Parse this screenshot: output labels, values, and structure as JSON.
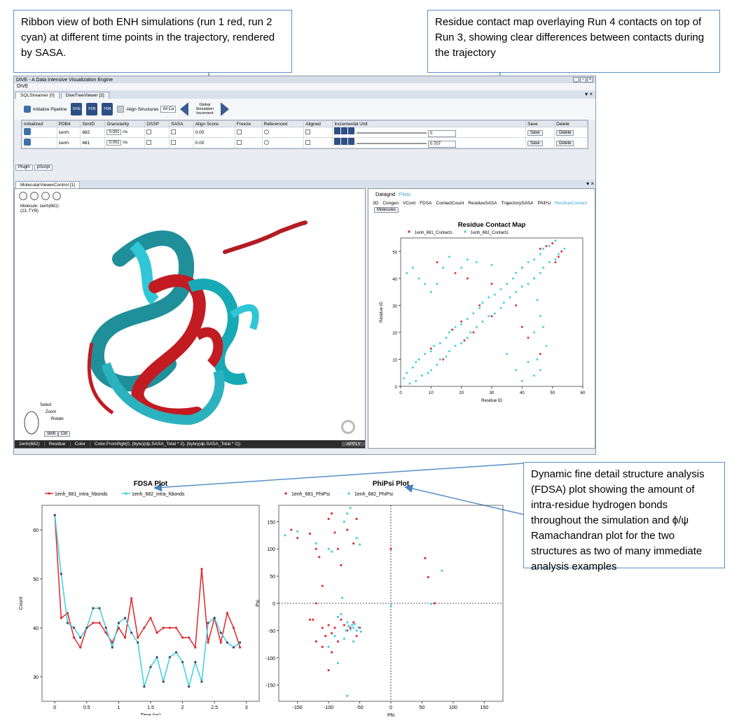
{
  "callouts": {
    "ribbon": "Ribbon view of both ENH simulations (run 1 red, run 2 cyan) at different time points in the trajectory, rendered by SASA.",
    "contact": "Residue contact map overlaying Run 4 contacts on top of Run 3, showing clear differences between contacts during the trajectory",
    "fdsa": "Dynamic fine detail structure analysis (FDSA) plot showing the amount of intra-residue hydrogen bonds throughout the simulation and ϕ/ψ Ramachandran plot for the two structures as two of many immediate analysis examples"
  },
  "app": {
    "title": "DIVE - A Data Intensive Visualization Engine",
    "menu": "DIVE",
    "tabs": [
      "SQLStreamer [0]",
      "DiveTreeViewer [2]"
    ],
    "toolbar": {
      "init": "Initialize Pipeline",
      "align": "Align Structures",
      "align_select": "All Ca",
      "global": "Global Simulation Increment"
    },
    "grid_headers": [
      "Initialized",
      "PDB4",
      "SimID",
      "Granularity",
      "DSSP",
      "SASA",
      "Align Score",
      "Freeze",
      "Referenced",
      "Aligned",
      "Incremental Unit",
      "Save",
      "Delete"
    ],
    "rows": [
      {
        "pdb": "1enh",
        "sim": "682",
        "gran": "0.001",
        "unit": "ns",
        "score": "0.00",
        "value": "0",
        "save": "Save",
        "delete": "Delete"
      },
      {
        "pdb": "1enh",
        "sim": "681",
        "gran": "0.001",
        "unit": "ns",
        "score": "0.00",
        "value": "0.707",
        "save": "Save",
        "delete": "Delete"
      }
    ],
    "bottom_tabs": [
      "Plugin",
      "pScript"
    ],
    "mvc_tab": "MolecularViewerControl [1]",
    "mol_info": [
      "Molecule: 1enh(681)",
      "(23, TYR)"
    ],
    "mouse_help": [
      "Select",
      "Zoom",
      "Rotate"
    ],
    "mouse_keys": [
      "Shift",
      "Ctrl"
    ],
    "status": [
      "1enh(682)",
      "Residue",
      "Color",
      "Color.FromRgb(0, (byte)(dp.SASA_Total * 2), (byte)(dp.SASA_Total * 2))",
      "APPLY"
    ],
    "datagrid": "Datagrid",
    "plots": "Plots",
    "plot_tabs": [
      "3D",
      "Congen",
      "VCont",
      "FDSA",
      "ContactCount",
      "ResidueSASA",
      "TrajectorySASA",
      "PhiPsi",
      "ResidueContact"
    ],
    "molecules_btn": "Molecules"
  },
  "colors": {
    "run1": "#e0262b",
    "run2": "#3ccfe0",
    "callout_border": "#5b8fc7"
  },
  "chart_data": [
    {
      "type": "scatter",
      "title": "Residue Contact Map",
      "xlabel": "Residue ID",
      "ylabel": "Residue ID",
      "xlim": [
        0,
        60
      ],
      "ylim": [
        0,
        55
      ],
      "xticks": [
        "0",
        "10",
        "20",
        "30",
        "40",
        "50",
        "60"
      ],
      "yticks": [
        "0",
        "10",
        "20",
        "30",
        "40",
        "50"
      ],
      "series": [
        {
          "name": "1enh_681_Contacts",
          "points": [
            [
              10,
              14
            ],
            [
              14,
              10
            ],
            [
              17,
              21
            ],
            [
              21,
              17
            ],
            [
              20,
              24
            ],
            [
              24,
              20
            ],
            [
              26,
              30
            ],
            [
              30,
              26
            ],
            [
              46,
              51
            ],
            [
              51,
              46
            ],
            [
              48,
              52
            ],
            [
              52,
              48
            ],
            [
              50,
              53
            ],
            [
              53,
              50
            ],
            [
              18,
              42
            ],
            [
              42,
              18
            ],
            [
              12,
              46
            ],
            [
              46,
              12
            ],
            [
              22,
              40
            ],
            [
              40,
              22
            ],
            [
              38,
              30
            ],
            [
              30,
              38
            ],
            [
              44,
              40
            ],
            [
              40,
              44
            ]
          ]
        },
        {
          "name": "1enh_682_Contacts",
          "points": [
            [
              1,
              3
            ],
            [
              3,
              1
            ],
            [
              2,
              5
            ],
            [
              5,
              2
            ],
            [
              4,
              7
            ],
            [
              7,
              4
            ],
            [
              5,
              9
            ],
            [
              9,
              5
            ],
            [
              6,
              10
            ],
            [
              10,
              6
            ],
            [
              8,
              12
            ],
            [
              12,
              8
            ],
            [
              10,
              13
            ],
            [
              13,
              10
            ],
            [
              11,
              15
            ],
            [
              15,
              11
            ],
            [
              13,
              16
            ],
            [
              16,
              13
            ],
            [
              15,
              18
            ],
            [
              18,
              15
            ],
            [
              16,
              20
            ],
            [
              20,
              16
            ],
            [
              18,
              22
            ],
            [
              22,
              18
            ],
            [
              20,
              23
            ],
            [
              23,
              20
            ],
            [
              22,
              25
            ],
            [
              25,
              22
            ],
            [
              24,
              27
            ],
            [
              27,
              24
            ],
            [
              26,
              29
            ],
            [
              29,
              26
            ],
            [
              27,
              31
            ],
            [
              31,
              27
            ],
            [
              29,
              33
            ],
            [
              33,
              29
            ],
            [
              31,
              34
            ],
            [
              34,
              31
            ],
            [
              33,
              36
            ],
            [
              36,
              33
            ],
            [
              35,
              38
            ],
            [
              38,
              35
            ],
            [
              37,
              40
            ],
            [
              40,
              37
            ],
            [
              38,
              42
            ],
            [
              42,
              38
            ],
            [
              40,
              44
            ],
            [
              44,
              40
            ],
            [
              42,
              46
            ],
            [
              46,
              42
            ],
            [
              44,
              47
            ],
            [
              47,
              44
            ],
            [
              46,
              49
            ],
            [
              49,
              46
            ],
            [
              47,
              51
            ],
            [
              51,
              47
            ],
            [
              49,
              52
            ],
            [
              52,
              49
            ],
            [
              51,
              54
            ],
            [
              54,
              51
            ],
            [
              2,
              42
            ],
            [
              4,
              44
            ],
            [
              6,
              40
            ],
            [
              8,
              38
            ],
            [
              10,
              35
            ],
            [
              12,
              38
            ],
            [
              14,
              44
            ],
            [
              16,
              48
            ],
            [
              40,
              2
            ],
            [
              44,
              4
            ],
            [
              42,
              9
            ],
            [
              38,
              6
            ],
            [
              35,
              12
            ],
            [
              45,
              10
            ],
            [
              48,
              15
            ],
            [
              46,
              6
            ],
            [
              20,
              44
            ],
            [
              22,
              47
            ],
            [
              44,
              20
            ],
            [
              47,
              22
            ],
            [
              30,
              45
            ],
            [
              45,
              32
            ],
            [
              25,
              46
            ],
            [
              46,
              26
            ]
          ]
        }
      ]
    },
    {
      "type": "line",
      "title": "FDSA Plot",
      "xlabel": "Time (ns)",
      "ylabel": "Count",
      "xlim": [
        -0.2,
        3.2
      ],
      "ylim": [
        25,
        65
      ],
      "xticks": [
        "0",
        "0.5",
        "1",
        "1.5",
        "2",
        "2.5",
        "3"
      ],
      "yticks": [
        "30",
        "40",
        "50",
        "60"
      ],
      "series": [
        {
          "name": "1enh_681_intra_hbonds",
          "x": [
            0,
            0.1,
            0.2,
            0.3,
            0.4,
            0.5,
            0.6,
            0.7,
            0.8,
            0.9,
            1.0,
            1.1,
            1.2,
            1.3,
            1.4,
            1.5,
            1.6,
            1.7,
            1.8,
            1.9,
            2.0,
            2.1,
            2.2,
            2.3,
            2.4,
            2.5,
            2.6,
            2.7,
            2.8,
            2.9
          ],
          "values": [
            63,
            42,
            43,
            38,
            36,
            40,
            41,
            41,
            39,
            37,
            40,
            38,
            46,
            38,
            40,
            42,
            39,
            40,
            40,
            40,
            38,
            38,
            36,
            52,
            37,
            42,
            37,
            43,
            40,
            36
          ]
        },
        {
          "name": "1enh_682_intra_hbonds",
          "x": [
            0,
            0.1,
            0.2,
            0.3,
            0.4,
            0.5,
            0.6,
            0.7,
            0.8,
            0.9,
            1.0,
            1.1,
            1.2,
            1.3,
            1.4,
            1.5,
            1.6,
            1.7,
            1.8,
            1.9,
            2.0,
            2.1,
            2.2,
            2.3,
            2.4,
            2.5,
            2.6,
            2.7,
            2.8,
            2.9
          ],
          "values": [
            63,
            51,
            41,
            40,
            38,
            40,
            44,
            44,
            40,
            36,
            41,
            42,
            39,
            37,
            28,
            32,
            34,
            29,
            34,
            35,
            33,
            28,
            33,
            29,
            41,
            42,
            39,
            37,
            36,
            37
          ]
        }
      ]
    },
    {
      "type": "scatter",
      "title": "PhiPsi Plot",
      "xlabel": "Phi",
      "ylabel": "Psi",
      "xlim": [
        -180,
        180
      ],
      "ylim": [
        -180,
        180
      ],
      "xticks": [
        "-150",
        "-100",
        "-50",
        "0",
        "50",
        "100",
        "150"
      ],
      "yticks": [
        "-150",
        "-100",
        "-50",
        "0",
        "50",
        "100",
        "150"
      ],
      "series": [
        {
          "name": "1enh_681_PhiPsi",
          "points": [
            [
              -160,
              135
            ],
            [
              -150,
              120
            ],
            [
              -130,
              128
            ],
            [
              -120,
              100
            ],
            [
              -115,
              85
            ],
            [
              -110,
              32
            ],
            [
              -100,
              155
            ],
            [
              -95,
              165
            ],
            [
              -90,
              130
            ],
            [
              -85,
              100
            ],
            [
              -80,
              70
            ],
            [
              -70,
              135
            ],
            [
              -60,
              110
            ],
            [
              -55,
              155
            ],
            [
              -120,
              0
            ],
            [
              -125,
              -30
            ],
            [
              -110,
              -45
            ],
            [
              -100,
              -40
            ],
            [
              -95,
              -55
            ],
            [
              -90,
              -45
            ],
            [
              -85,
              -70
            ],
            [
              -80,
              -30
            ],
            [
              -75,
              -40
            ],
            [
              -70,
              -50
            ],
            [
              -65,
              -45
            ],
            [
              -60,
              -35
            ],
            [
              -55,
              -60
            ],
            [
              -50,
              -45
            ],
            [
              -110,
              -80
            ],
            [
              -95,
              -90
            ],
            [
              -100,
              -123
            ],
            [
              0,
              100
            ],
            [
              55,
              83
            ],
            [
              60,
              48
            ],
            [
              70,
              0
            ],
            [
              -130,
              -30
            ],
            [
              -105,
              -60
            ],
            [
              -120,
              -70
            ]
          ]
        },
        {
          "name": "1enh_682_PhiPsi",
          "points": [
            [
              -170,
              125
            ],
            [
              -150,
              132
            ],
            [
              -120,
              110
            ],
            [
              -100,
              100
            ],
            [
              -95,
              95
            ],
            [
              -75,
              150
            ],
            [
              -70,
              165
            ],
            [
              -65,
              175
            ],
            [
              -55,
              120
            ],
            [
              -50,
              108
            ],
            [
              -60,
              -45
            ],
            [
              -62,
              -40
            ],
            [
              -58,
              -38
            ],
            [
              -65,
              -48
            ],
            [
              -68,
              -42
            ],
            [
              -55,
              -50
            ],
            [
              -52,
              -44
            ],
            [
              -70,
              -35
            ],
            [
              -72,
              -50
            ],
            [
              -48,
              -52
            ],
            [
              -80,
              -20
            ],
            [
              -85,
              -25
            ],
            [
              -90,
              -60
            ],
            [
              -75,
              -65
            ],
            [
              -60,
              -70
            ],
            [
              -100,
              -80
            ],
            [
              -85,
              -110
            ],
            [
              -70,
              -170
            ],
            [
              0,
              -5
            ],
            [
              82,
              60
            ],
            [
              65,
              -1
            ],
            [
              -78,
              10
            ]
          ]
        }
      ]
    }
  ]
}
